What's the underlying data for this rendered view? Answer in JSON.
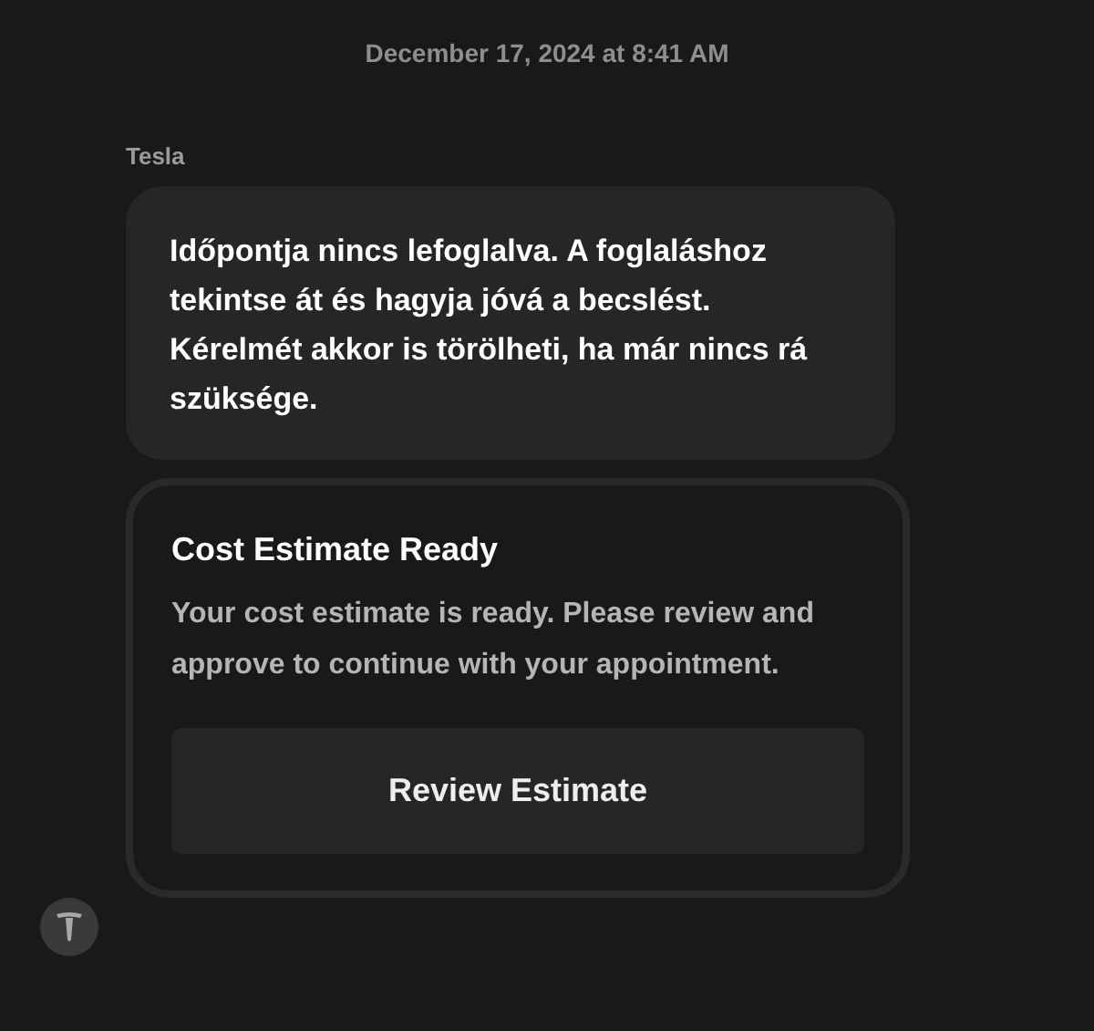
{
  "timestamp": "December 17, 2024 at 8:41 AM",
  "sender": "Tesla",
  "message": "Időpontja nincs lefoglalva. A foglaláshoz tekintse át és hagyja jóvá a becslést. Kérelmét akkor is törölheti, ha már nincs rá szüksége.",
  "card": {
    "title": "Cost Estimate Ready",
    "body": "Your cost estimate is ready. Please review and approve to continue with your appointment.",
    "button": "Review Estimate"
  }
}
